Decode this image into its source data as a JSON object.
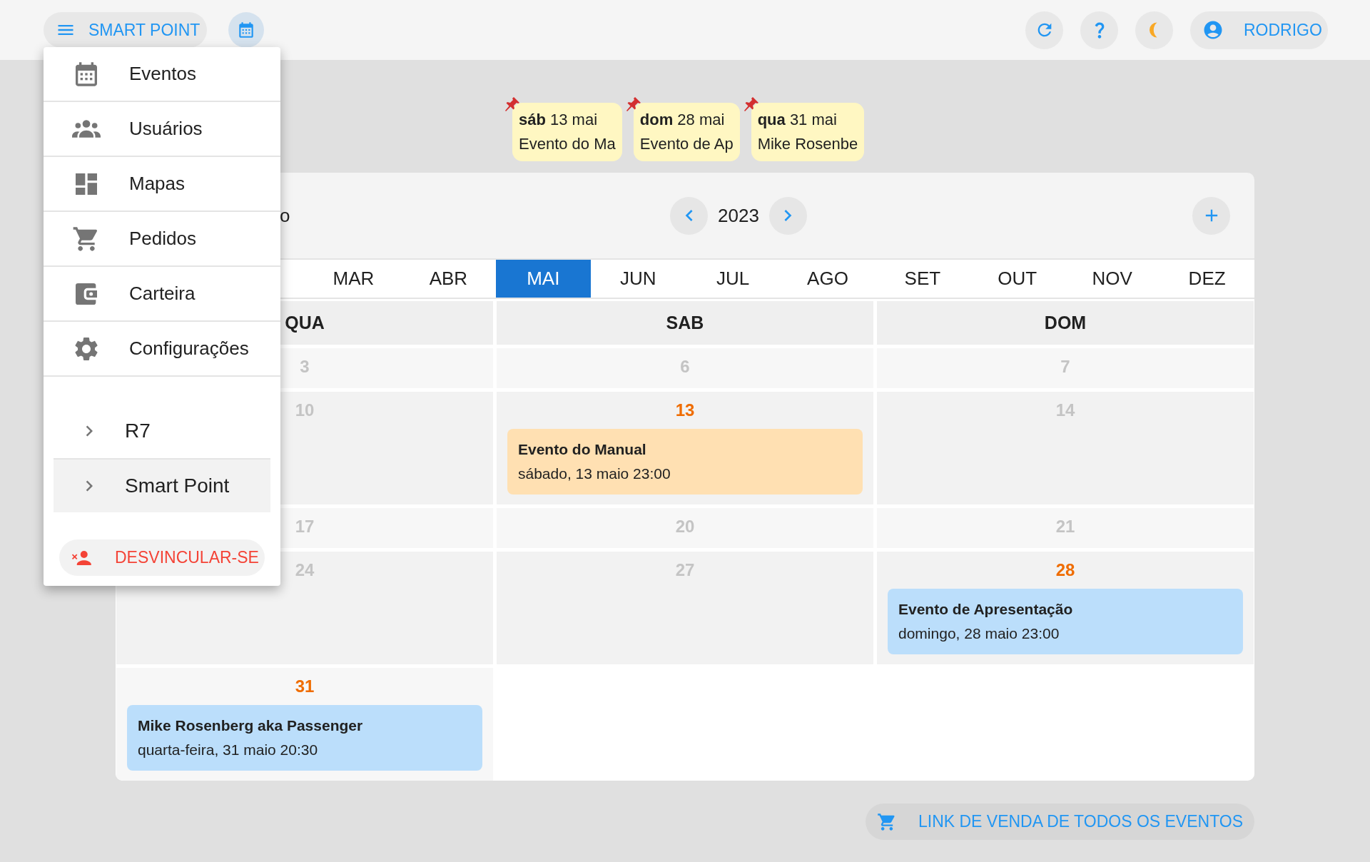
{
  "top_bar": {
    "app_button": "SMART POINT",
    "user_button": "RODRIGO"
  },
  "pinned_events": [
    {
      "weekday": "sáb",
      "date": "13 mai",
      "title": "Evento do Ma"
    },
    {
      "weekday": "dom",
      "date": "28 mai",
      "title": "Evento de Ap"
    },
    {
      "weekday": "qua",
      "date": "31 mai",
      "title": "Mike Rosenbe"
    }
  ],
  "calendar": {
    "title": "o",
    "year": "2023",
    "months": [
      {
        "label": "MAR",
        "selected": false
      },
      {
        "label": "ABR",
        "selected": false
      },
      {
        "label": "MAI",
        "selected": true
      },
      {
        "label": "JUN",
        "selected": false
      },
      {
        "label": "JUL",
        "selected": false
      },
      {
        "label": "AGO",
        "selected": false
      },
      {
        "label": "SET",
        "selected": false
      },
      {
        "label": "OUT",
        "selected": false
      },
      {
        "label": "NOV",
        "selected": false
      },
      {
        "label": "DEZ",
        "selected": false
      }
    ],
    "columns": [
      "QUA",
      "SAB",
      "DOM"
    ],
    "weeks": [
      {
        "cells": [
          {
            "day": "3",
            "highlighted": false
          },
          {
            "day": "6",
            "highlighted": false
          },
          {
            "day": "7",
            "highlighted": false
          }
        ]
      },
      {
        "cells": [
          {
            "day": "10",
            "highlighted": false
          },
          {
            "day": "13",
            "highlighted": true,
            "events": [
              {
                "title": "Evento do Manual",
                "when": "sábado, 13 maio 23:00",
                "color": "#ffe0b2"
              }
            ]
          },
          {
            "day": "14",
            "highlighted": false
          }
        ]
      },
      {
        "cells": [
          {
            "day": "17",
            "highlighted": false
          },
          {
            "day": "20",
            "highlighted": false
          },
          {
            "day": "21",
            "highlighted": false
          }
        ]
      },
      {
        "cells": [
          {
            "day": "24",
            "highlighted": false
          },
          {
            "day": "27",
            "highlighted": false
          },
          {
            "day": "28",
            "highlighted": true,
            "events": [
              {
                "title": "Evento de Apresentação",
                "when": "domingo, 28 maio 23:00",
                "color": "#bbdefb"
              }
            ]
          }
        ]
      },
      {
        "cells": [
          {
            "day": "31",
            "highlighted": true,
            "events": [
              {
                "title": "Mike Rosenberg aka Passenger",
                "when": "quarta-feira, 31 maio 20:30",
                "color": "#bbdefb"
              }
            ]
          }
        ]
      }
    ]
  },
  "sales_link": "LINK DE VENDA DE TODOS OS EVENTOS",
  "menu": {
    "items": [
      "Eventos",
      "Usuários",
      "Mapas",
      "Pedidos",
      "Carteira",
      "Configurações"
    ],
    "groups": [
      {
        "label": "R7",
        "selected": false
      },
      {
        "label": "Smart Point",
        "selected": true
      }
    ],
    "leave_button": "DESVINCULAR-SE"
  }
}
